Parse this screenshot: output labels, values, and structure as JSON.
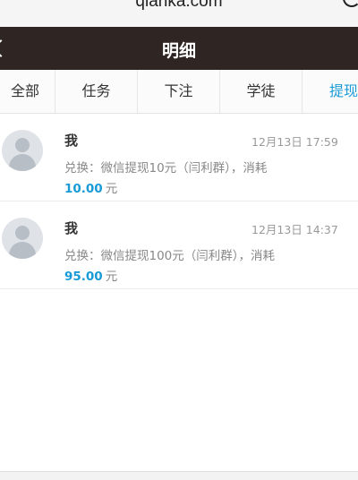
{
  "browser": {
    "url": "qianka.com"
  },
  "header": {
    "title": "明细"
  },
  "tabs": [
    {
      "label": "全部"
    },
    {
      "label": "任务"
    },
    {
      "label": "下注"
    },
    {
      "label": "学徒"
    },
    {
      "label": "提现"
    }
  ],
  "active_tab": "提现",
  "accent_color": "#1a9bd6",
  "records": [
    {
      "user": "我",
      "time": "12月13日 17:59",
      "description": "兑换：微信提现10元（闫利群），消耗",
      "amount": "10.00",
      "unit": "元"
    },
    {
      "user": "我",
      "time": "12月13日 14:37",
      "description": "兑换：微信提现100元（闫利群），消耗",
      "amount": "95.00",
      "unit": "元"
    }
  ]
}
